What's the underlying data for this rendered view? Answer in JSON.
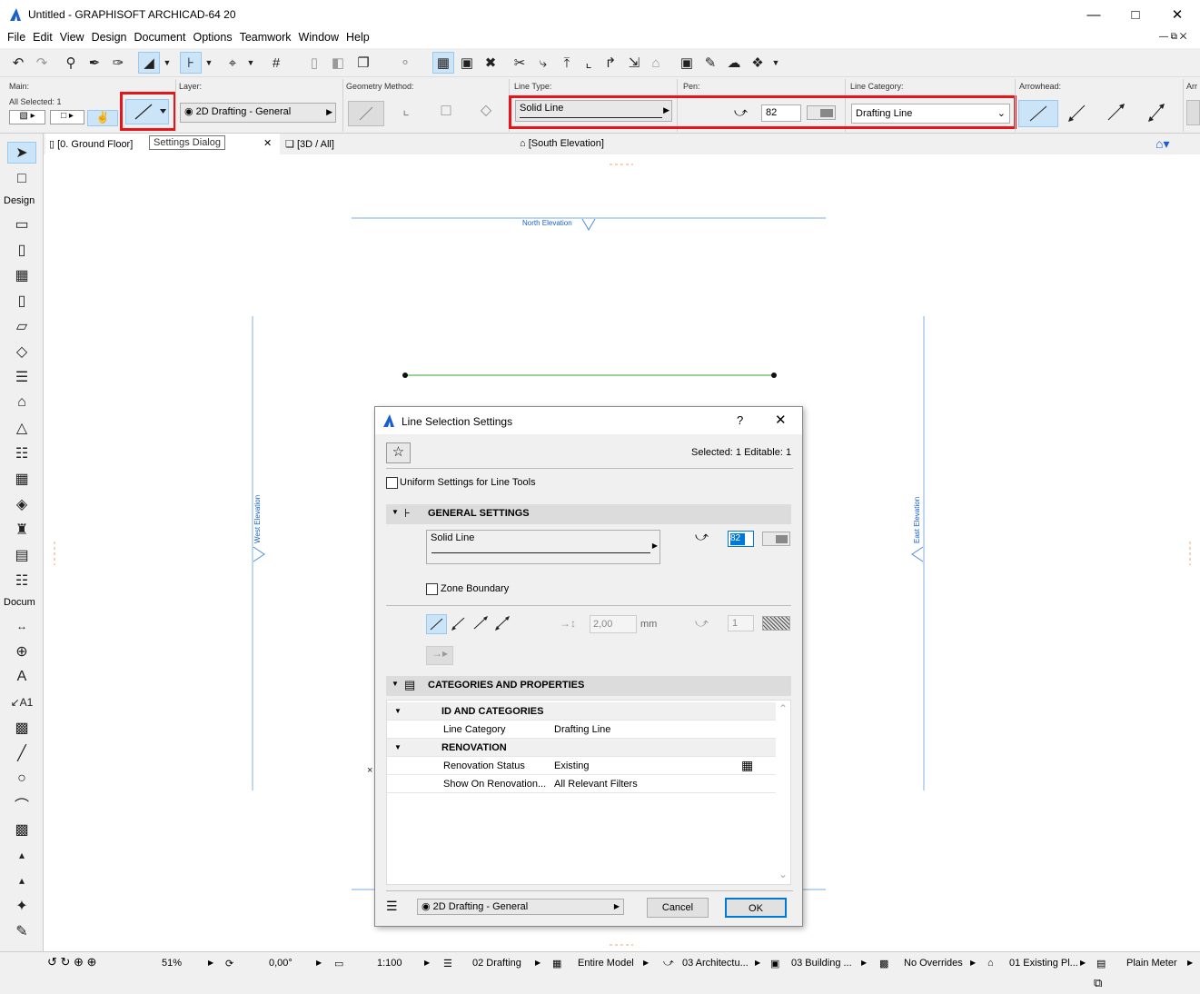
{
  "app": {
    "title": "Untitled - GRAPHISOFT ARCHICAD-64 20"
  },
  "menu": [
    "File",
    "Edit",
    "View",
    "Design",
    "Document",
    "Options",
    "Teamwork",
    "Window",
    "Help"
  ],
  "infobox": {
    "main_label": "Main:",
    "all_selected": "All Selected: 1",
    "layer_label": "Layer:",
    "layer_value": "2D Drafting - General",
    "geometry_label": "Geometry Method:",
    "linetype_label": "Line Type:",
    "linetype_value": "Solid Line",
    "pen_label": "Pen:",
    "pen_value": "82",
    "linecat_label": "Line Category:",
    "linecat_value": "Drafting Line",
    "arrow_label": "Arrowhead:",
    "arr_trunc": "Arr",
    "tooltip": "Settings Dialog"
  },
  "tabs": [
    "[0. Ground Floor]",
    "[3D / All]",
    "[South Elevation]"
  ],
  "toolbox": {
    "design": "Design",
    "document": "Docum"
  },
  "canvas": {
    "north": "North Elevation",
    "west": "West Elevation",
    "east": "East Elevation",
    "colors": {
      "marker": "#1a5fcc",
      "line": "#5cb85c"
    }
  },
  "status": {
    "zoom": "51%",
    "angle": "0,00°",
    "scale": "1:100",
    "layer_combo": "02 Drafting",
    "model": "Entire Model",
    "pen_set": "03 Architectu...",
    "mvo": "03 Building ...",
    "overrides": "No Overrides",
    "renovation": "01 Existing Pl...",
    "dimension": "Plain Meter"
  },
  "dialog": {
    "title": "Line Selection Settings",
    "help": "?",
    "selected": "Selected: 1 Editable: 1",
    "uniform": "Uniform Settings for Line Tools",
    "general": "GENERAL SETTINGS",
    "linetype": "Solid Line",
    "pen": "82",
    "zone": "Zone Boundary",
    "size": "2,00",
    "unit": "mm",
    "arrow_pen": "1",
    "categories": "CATEGORIES AND PROPERTIES",
    "id_cat": "ID AND CATEGORIES",
    "line_cat_label": "Line Category",
    "line_cat_value": "Drafting Line",
    "renovation": "RENOVATION",
    "ren_status_label": "Renovation Status",
    "ren_status_value": "Existing",
    "show_on_label": "Show On Renovation...",
    "show_on_value": "All Relevant Filters",
    "layer": "2D Drafting - General",
    "cancel": "Cancel",
    "ok": "OK"
  }
}
